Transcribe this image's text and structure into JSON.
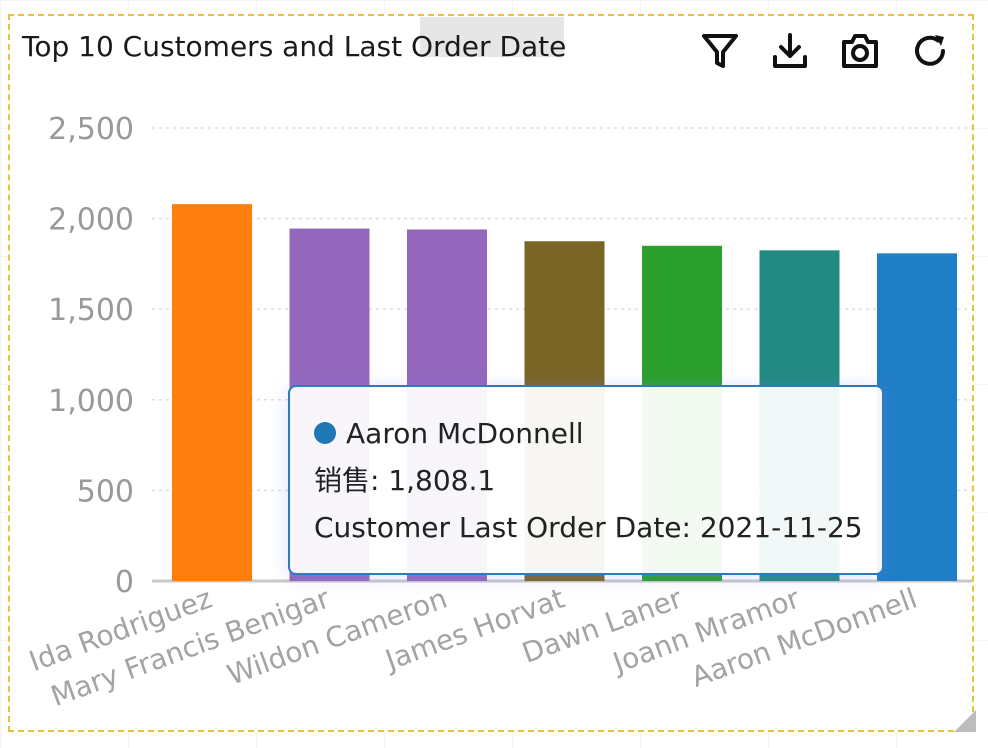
{
  "title": "Top 10 Customers and Last Order Date",
  "toolbar": {
    "icons": [
      "filter-icon",
      "download-icon",
      "camera-icon",
      "refresh-icon"
    ]
  },
  "chart_data": {
    "type": "bar",
    "title": "Top 10 Customers and Last Order Date",
    "categories": [
      "Ida Rodriguez",
      "Mary Francis Benigar",
      "Wildon Cameron",
      "James Horvat",
      "Dawn Laner",
      "Joann Mramor",
      "Aaron McDonnell"
    ],
    "values": [
      2080,
      1945,
      1940,
      1875,
      1850,
      1825,
      1808.1
    ],
    "colors": [
      "#ff7f0e",
      "#9467bd",
      "#9467bd",
      "#7a6426",
      "#2ca02c",
      "#238a82",
      "#1f7ec6"
    ],
    "ylim": [
      0,
      2500
    ],
    "yticks": [
      0,
      500,
      1000,
      1500,
      2000,
      2500
    ],
    "ytick_labels": [
      "0",
      "500",
      "1,000",
      "1,500",
      "2,000",
      "2,500"
    ],
    "grid": true,
    "xlabel": "",
    "ylabel": ""
  },
  "tooltip": {
    "name": "Aaron McDonnell",
    "color": "#1f77b4",
    "value_line": "销售: 1,808.1",
    "date_line": "Customer Last Order Date: 2021-11-25"
  }
}
